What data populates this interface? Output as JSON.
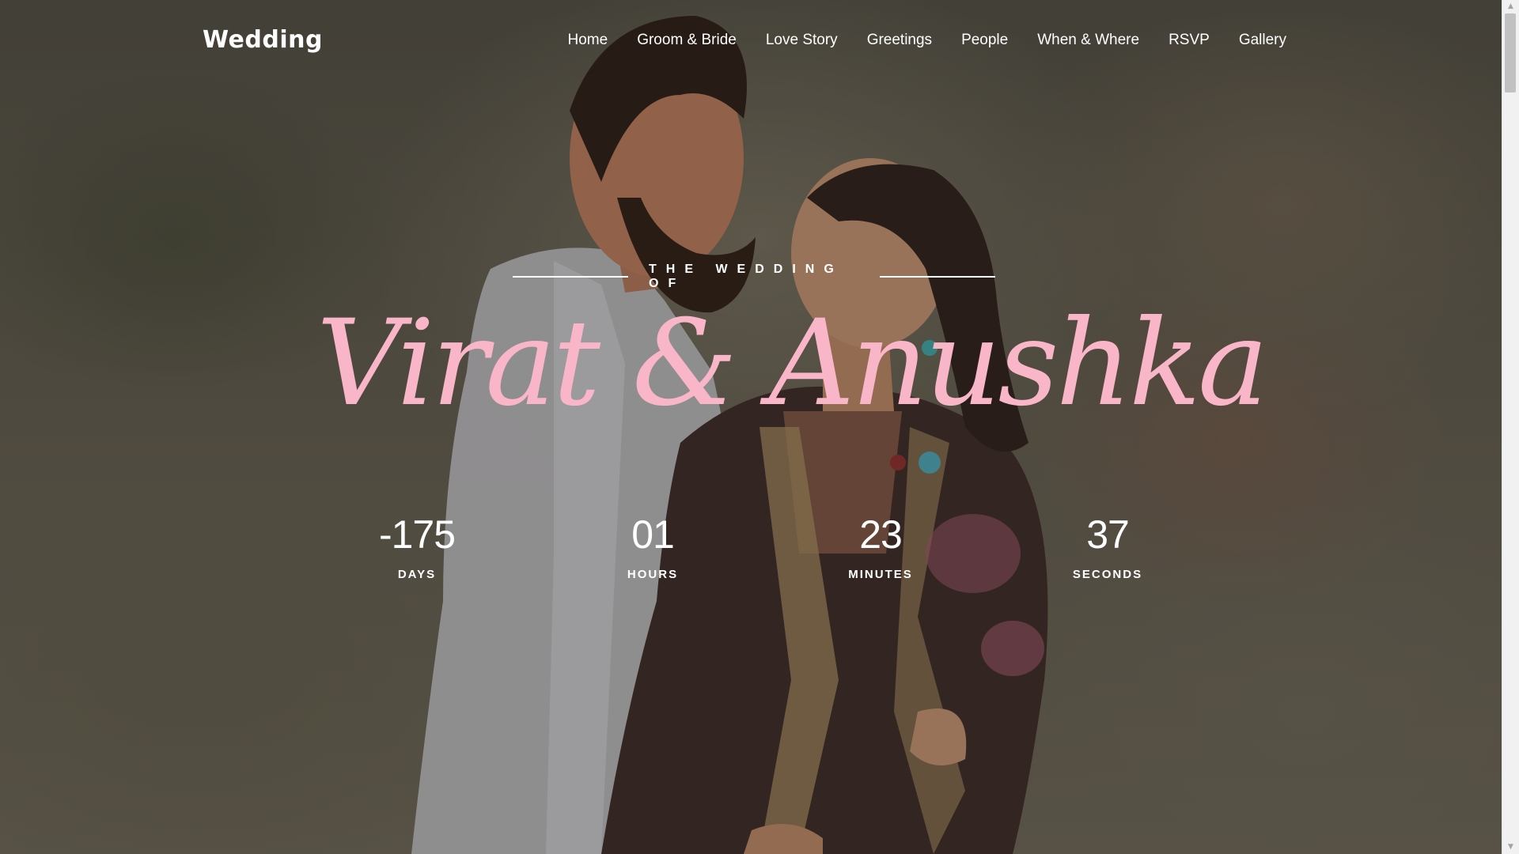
{
  "header": {
    "logo": "Wedding",
    "nav": [
      "Home",
      "Groom & Bride",
      "Love Story",
      "Greetings",
      "People",
      "When & Where",
      "RSVP",
      "Gallery"
    ]
  },
  "hero": {
    "subtitle": "THE WEDDING OF",
    "names": "Virat & Anushka",
    "name_color": "#f9b6c8"
  },
  "countdown": [
    {
      "value": "-175",
      "label": "DAYS"
    },
    {
      "value": "01",
      "label": "HOURS"
    },
    {
      "value": "23",
      "label": "MINUTES"
    },
    {
      "value": "37",
      "label": "SECONDS"
    }
  ],
  "icons": {
    "scroll_up": "triangle-up-icon",
    "scroll_down": "triangle-down-icon"
  }
}
